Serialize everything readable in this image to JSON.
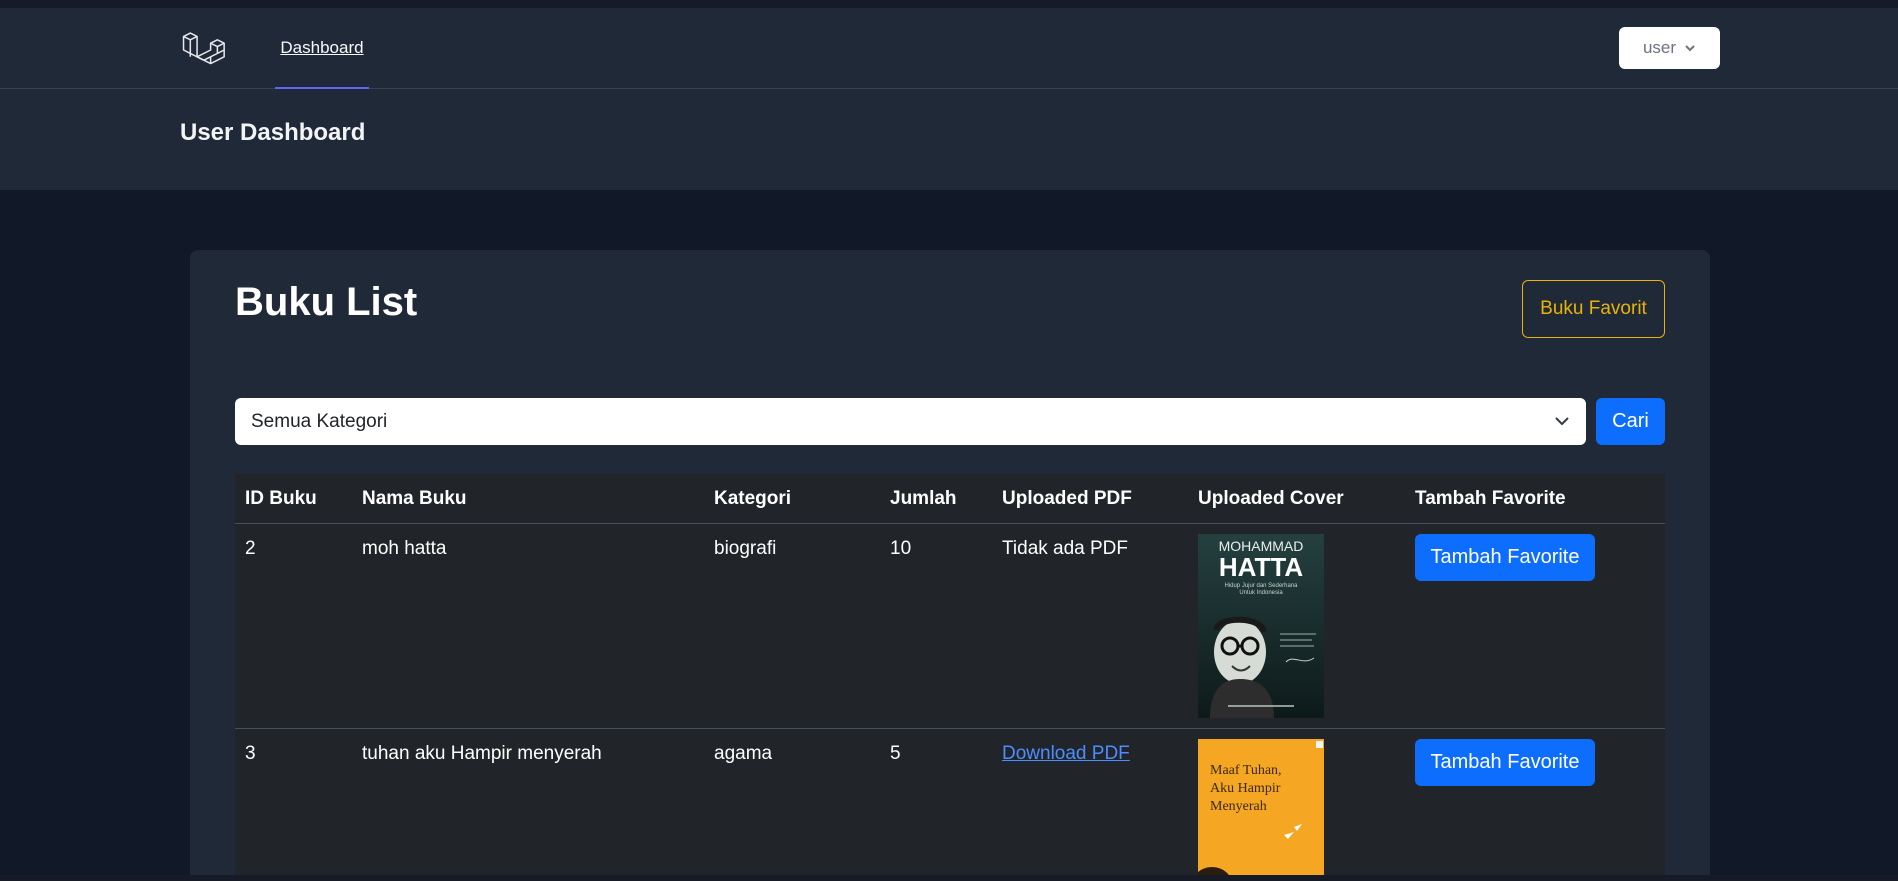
{
  "nav": {
    "link_label": "Dashboard",
    "user_label": "user",
    "user_chevron_icon": "chevron-down-icon",
    "logo_icon": "laravel-logo-icon"
  },
  "header": {
    "title": "User Dashboard"
  },
  "card": {
    "title": "Buku List",
    "favorites_button": "Buku Favorit"
  },
  "filter": {
    "selected": "Semua Kategori",
    "search_button": "Cari"
  },
  "table": {
    "headers": [
      "ID Buku",
      "Nama Buku",
      "Kategori",
      "Jumlah",
      "Uploaded PDF",
      "Uploaded Cover",
      "Tambah Favorite"
    ],
    "rows": [
      {
        "id": "2",
        "name": "moh hatta",
        "category": "biografi",
        "qty": "10",
        "pdf": "Tidak ada PDF",
        "action": "Tambah Favorite",
        "cover": {
          "line1": "MOHAMMAD",
          "line2": "HATTA",
          "subtitle1": "Hidup Jujur dan Sederhana",
          "subtitle2": "Untuk Indonesia"
        }
      },
      {
        "id": "3",
        "name": "tuhan aku Hampir menyerah",
        "category": "agama",
        "qty": "5",
        "pdf": "Download PDF",
        "action": "Tambah Favorite",
        "cover": {
          "line1": "Maaf Tuhan,",
          "line2": "Aku Hampir",
          "line3": "Menyerah"
        }
      }
    ]
  },
  "colors": {
    "page_bg": "#111827",
    "panel_bg": "#1f2937",
    "table_bg": "#212529",
    "primary": "#0d6efd",
    "warning": "#eab308",
    "link": "#4c8dff"
  }
}
